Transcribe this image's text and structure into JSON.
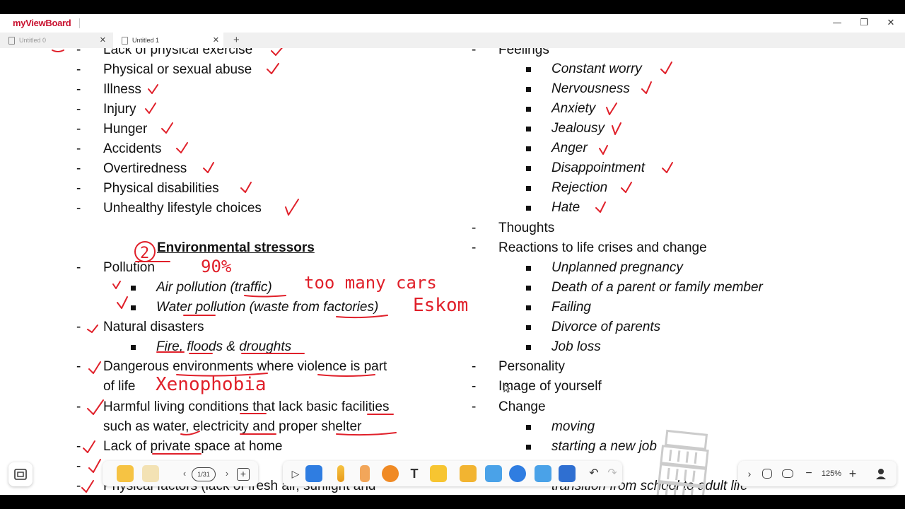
{
  "app": {
    "logo_prefix": "my",
    "logo_name": "ViewBoard",
    "logo_mark": "®"
  },
  "window_controls": {
    "minimize": "—",
    "maximize": "❐",
    "close": "✕"
  },
  "tabs": [
    {
      "label": "Untitled 0",
      "active": false
    },
    {
      "label": "Untitled 1",
      "active": true
    }
  ],
  "tab_add": "+",
  "left_column": {
    "items": [
      {
        "text": "Lack of physical exercise"
      },
      {
        "text": "Physical or sexual abuse"
      },
      {
        "text": "Illness"
      },
      {
        "text": "Injury"
      },
      {
        "text": "Hunger"
      },
      {
        "text": "Accidents"
      },
      {
        "text": "Overtiredness"
      },
      {
        "text": "Physical disabilities"
      },
      {
        "text": "Unhealthy lifestyle choices"
      }
    ],
    "heading": "Environmental  stressors",
    "pollution": "Pollution",
    "air": "Air pollution (traffic)",
    "water": "Water pollution (waste from factories)",
    "natural": "Natural disasters",
    "fire": "Fire, floods & droughts",
    "dangerous_1": "Dangerous environments where violence is part",
    "dangerous_2": "of life",
    "harmful_1": "Harmful living conditions that lack basic facilities",
    "harmful_2": "such as water, electricity and proper shelter",
    "private": "Lack of private space at home",
    "physical_factors": "Physical factors (lack of fresh air, sunlight and"
  },
  "right_column": {
    "feelings": "Feelings",
    "feeling_items": [
      "Constant worry",
      "Nervousness",
      "Anxiety",
      "Jealousy",
      "Anger",
      "Disappointment",
      "Rejection",
      "Hate"
    ],
    "thoughts": "Thoughts",
    "reactions": "Reactions to life crises and change",
    "reaction_items": [
      "Unplanned pregnancy",
      "Death of a parent or family member",
      "Failing",
      "Divorce of parents",
      "Job loss"
    ],
    "personality": "Personality",
    "image": "Image of yourself",
    "change": "Change",
    "change_items": [
      "moving",
      "starting a new job"
    ],
    "transition": "transition from school to adult life"
  },
  "annotations": {
    "number": "2",
    "percent": "90%",
    "too_many_cars": "too many cars",
    "eskom": "Eskom",
    "xenophobia": "Xenophobia"
  },
  "toolbar": {
    "page_indicator": "1/31",
    "zoom": "125%"
  },
  "colors": {
    "ink": "#e0202a",
    "brand": "#c8102e",
    "accent": "#2f7de1"
  }
}
